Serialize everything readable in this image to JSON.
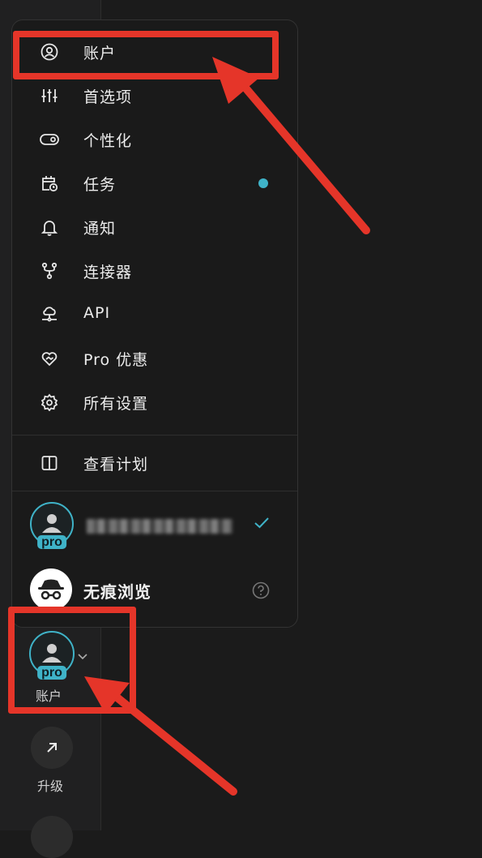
{
  "menu": {
    "items": [
      {
        "label": "账户",
        "icon": "user-circle-icon"
      },
      {
        "label": "首选项",
        "icon": "sliders-icon"
      },
      {
        "label": "个性化",
        "icon": "toggle-icon"
      },
      {
        "label": "任务",
        "icon": "calendar-clock-icon",
        "has_dot": true
      },
      {
        "label": "通知",
        "icon": "bell-icon"
      },
      {
        "label": "连接器",
        "icon": "fork-icon"
      },
      {
        "label": "API",
        "icon": "cloud-network-icon"
      },
      {
        "label": "Pro 优惠",
        "icon": "heart-hand-icon"
      },
      {
        "label": "所有设置",
        "icon": "gear-icon"
      }
    ],
    "plan": {
      "label": "查看计划",
      "icon": "columns-icon"
    },
    "accounts": [
      {
        "badge": "pro",
        "selected": true
      },
      {
        "label": "无痕浏览",
        "icon": "incognito-icon",
        "help_icon": "question-icon"
      }
    ]
  },
  "sidebar": {
    "account": {
      "badge": "pro",
      "label": "账户"
    },
    "upgrade": {
      "label": "升级",
      "icon": "arrow-up-right-icon"
    }
  },
  "colors": {
    "accent": "#3fb3c8",
    "annotation": "#e53529",
    "bg": "#1b1b1b"
  }
}
